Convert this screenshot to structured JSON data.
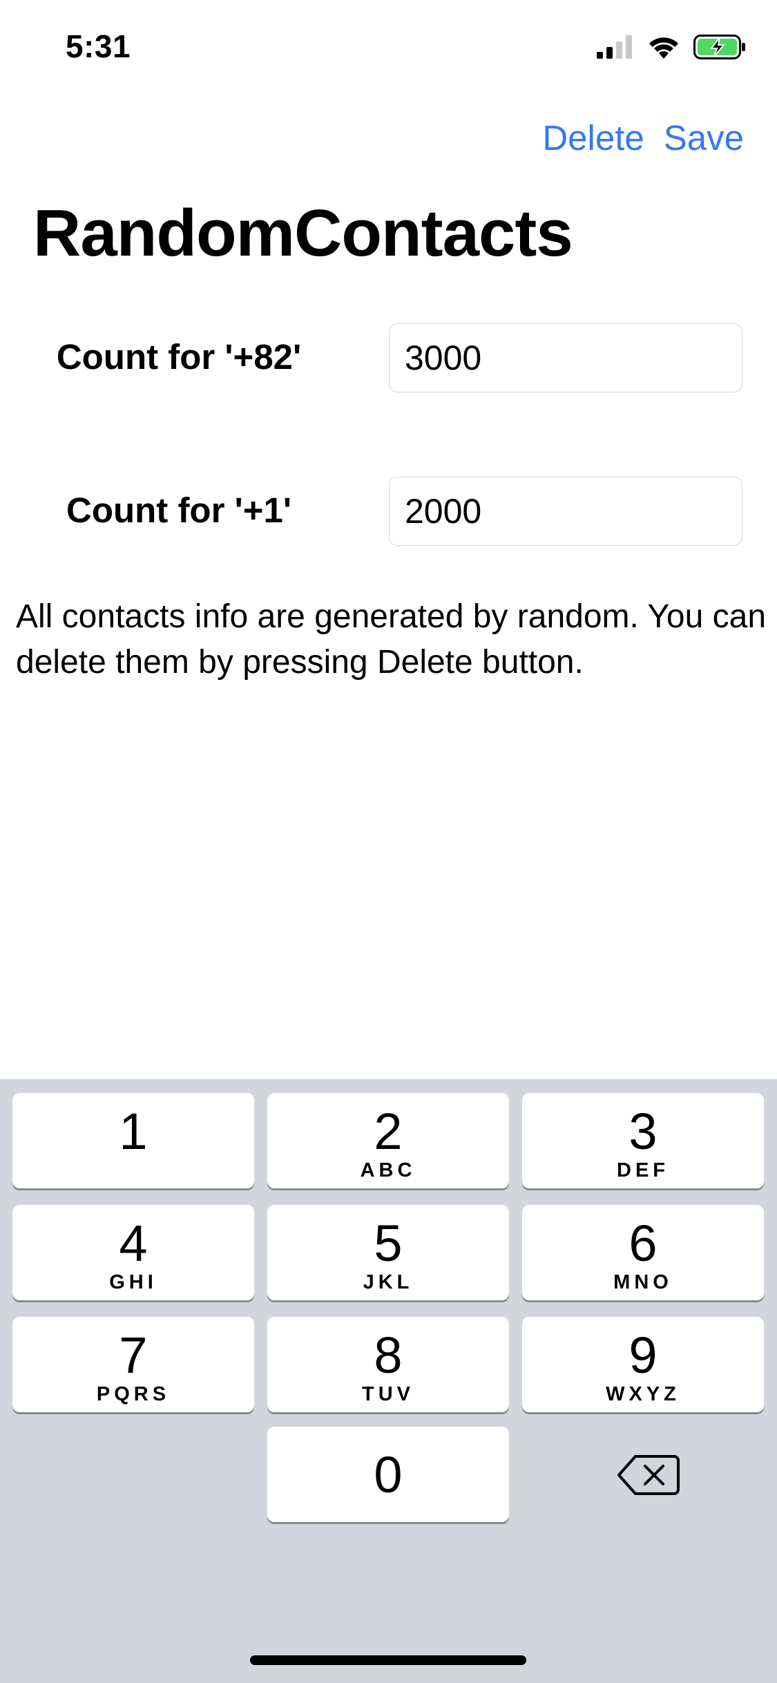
{
  "status_bar": {
    "time": "5:31",
    "icons": [
      "cellular-signal-icon",
      "wifi-icon",
      "battery-charging-icon"
    ],
    "battery_color": "#4CD964"
  },
  "nav": {
    "delete_label": "Delete",
    "save_label": "Save",
    "accent_color": "#3478F6"
  },
  "page": {
    "title": "RandomContacts"
  },
  "form": {
    "rows": [
      {
        "label": "Count for '+82'",
        "value": "3000"
      },
      {
        "label": "Count for '+1'",
        "value": "2000"
      }
    ]
  },
  "info": {
    "text": "All contacts info are generated by random. You can delete them by pressing Delete button."
  },
  "keyboard": {
    "keys": [
      {
        "digit": "1",
        "letters": ""
      },
      {
        "digit": "2",
        "letters": "ABC"
      },
      {
        "digit": "3",
        "letters": "DEF"
      },
      {
        "digit": "4",
        "letters": "GHI"
      },
      {
        "digit": "5",
        "letters": "JKL"
      },
      {
        "digit": "6",
        "letters": "MNO"
      },
      {
        "digit": "7",
        "letters": "PQRS"
      },
      {
        "digit": "8",
        "letters": "TUV"
      },
      {
        "digit": "9",
        "letters": "WXYZ"
      },
      {
        "digit": "0",
        "letters": ""
      }
    ],
    "delete_icon": "backspace-icon"
  }
}
